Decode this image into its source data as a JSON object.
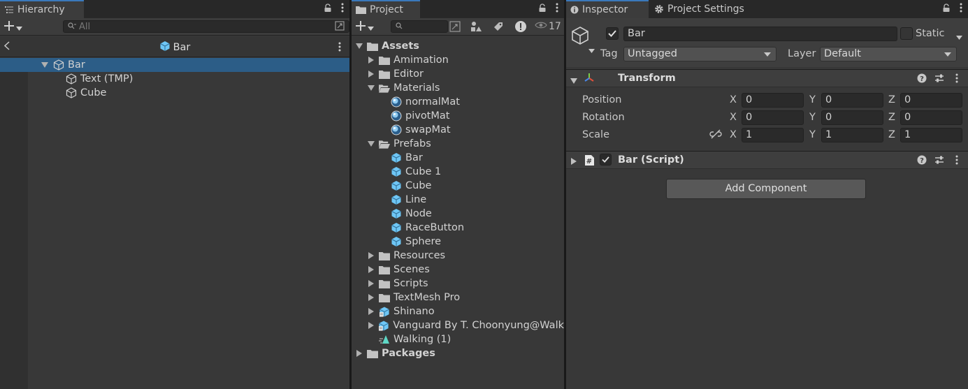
{
  "hierarchy": {
    "tab_label": "Hierarchy",
    "search_placeholder": "All",
    "breadcrumb": "Bar",
    "items": [
      {
        "label": "Bar",
        "depth": 0,
        "selected": true,
        "expanded": true
      },
      {
        "label": "Text (TMP)",
        "depth": 1,
        "selected": false
      },
      {
        "label": "Cube",
        "depth": 1,
        "selected": false
      }
    ]
  },
  "project": {
    "tab_label": "Project",
    "hidden_count": "17",
    "tree": [
      {
        "label": "Assets",
        "depth": 0,
        "icon": "folder-icon",
        "arrow": "down",
        "bold": true
      },
      {
        "label": "Amimation",
        "depth": 1,
        "icon": "folder-icon",
        "arrow": "right"
      },
      {
        "label": "Editor",
        "depth": 1,
        "icon": "folder-icon",
        "arrow": "right"
      },
      {
        "label": "Materials",
        "depth": 1,
        "icon": "folder-open-icon",
        "arrow": "down"
      },
      {
        "label": "normalMat",
        "depth": 2,
        "icon": "material-icon",
        "arrow": ""
      },
      {
        "label": "pivotMat",
        "depth": 2,
        "icon": "material-icon",
        "arrow": ""
      },
      {
        "label": "swapMat",
        "depth": 2,
        "icon": "material-icon",
        "arrow": ""
      },
      {
        "label": "Prefabs",
        "depth": 1,
        "icon": "folder-open-icon",
        "arrow": "down"
      },
      {
        "label": "Bar",
        "depth": 2,
        "icon": "prefab-icon",
        "arrow": ""
      },
      {
        "label": "Cube 1",
        "depth": 2,
        "icon": "prefab-icon",
        "arrow": ""
      },
      {
        "label": "Cube",
        "depth": 2,
        "icon": "prefab-icon",
        "arrow": ""
      },
      {
        "label": "Line",
        "depth": 2,
        "icon": "prefab-icon",
        "arrow": ""
      },
      {
        "label": "Node",
        "depth": 2,
        "icon": "prefab-icon",
        "arrow": ""
      },
      {
        "label": "RaceButton",
        "depth": 2,
        "icon": "prefab-icon",
        "arrow": ""
      },
      {
        "label": "Sphere",
        "depth": 2,
        "icon": "prefab-icon",
        "arrow": ""
      },
      {
        "label": "Resources",
        "depth": 1,
        "icon": "folder-icon",
        "arrow": "right"
      },
      {
        "label": "Scenes",
        "depth": 1,
        "icon": "folder-icon",
        "arrow": "right"
      },
      {
        "label": "Scripts",
        "depth": 1,
        "icon": "folder-icon",
        "arrow": "right"
      },
      {
        "label": "TextMesh Pro",
        "depth": 1,
        "icon": "folder-icon",
        "arrow": "right"
      },
      {
        "label": "Shinano",
        "depth": 1,
        "icon": "model-icon",
        "arrow": "right"
      },
      {
        "label": "Vanguard By T. Choonyung@Walk",
        "depth": 1,
        "icon": "model-icon",
        "arrow": "right"
      },
      {
        "label": "Walking (1)",
        "depth": 1,
        "icon": "animation-clip-icon",
        "arrow": ""
      },
      {
        "label": "Packages",
        "depth": 0,
        "icon": "folder-icon",
        "arrow": "right",
        "bold": true
      }
    ]
  },
  "inspector": {
    "tab_label": "Inspector",
    "settings_tab_label": "Project Settings",
    "object_name": "Bar",
    "static_label": "Static",
    "tag_label": "Tag",
    "tag_value": "Untagged",
    "layer_label": "Layer",
    "layer_value": "Default",
    "transform": {
      "title": "Transform",
      "position_label": "Position",
      "rotation_label": "Rotation",
      "scale_label": "Scale",
      "axis_x": "X",
      "axis_y": "Y",
      "axis_z": "Z",
      "position": [
        "0",
        "0",
        "0"
      ],
      "rotation": [
        "0",
        "0",
        "0"
      ],
      "scale": [
        "1",
        "1",
        "1"
      ]
    },
    "script_component_title": "Bar (Script)",
    "add_component_label": "Add Component"
  },
  "colors": {
    "selection": "#2c5d87",
    "accent_tab": "#3a79bb",
    "prefab_blue": "#6ec6f5"
  }
}
